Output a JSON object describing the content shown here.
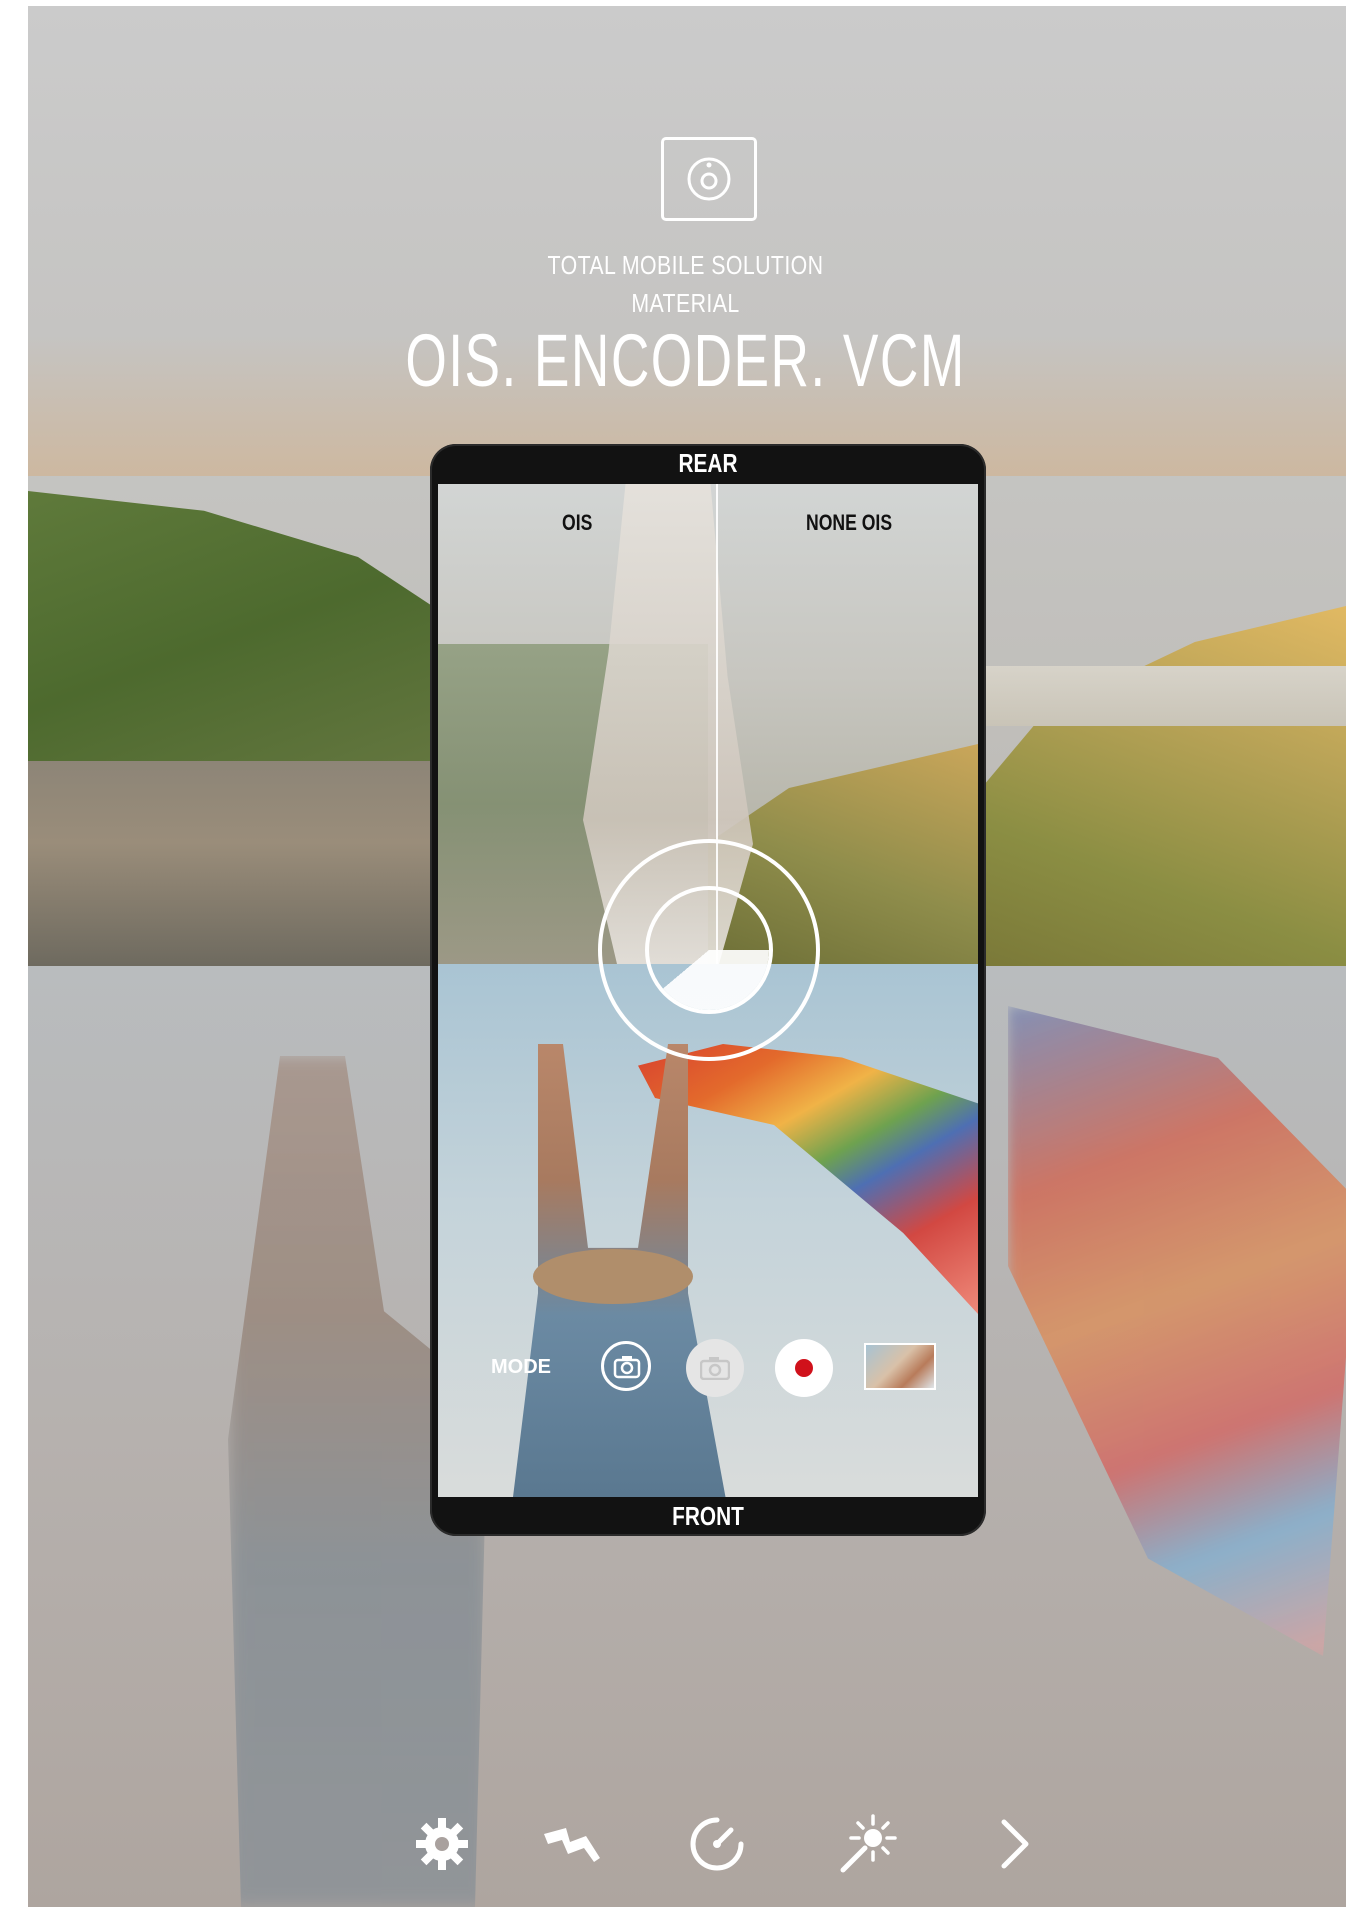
{
  "header": {
    "line1": "TOTAL MOBILE SOLUTION",
    "line2": "MATERIAL",
    "title": "OIS. ENCODER. VCM"
  },
  "phone": {
    "top_label": "REAR",
    "bottom_label": "FRONT",
    "left_label": "OIS",
    "right_label": "NONE OIS"
  },
  "camera_controls": {
    "mode_label": "MODE"
  },
  "toolbar": {
    "icons": [
      "gear-icon",
      "flash-icon",
      "stabilizer-icon",
      "magic-wand-icon",
      "chevron-right-icon"
    ]
  },
  "colors": {
    "record_red": "#d0111b",
    "text_white": "#ffffff",
    "frame_black": "#121212"
  }
}
